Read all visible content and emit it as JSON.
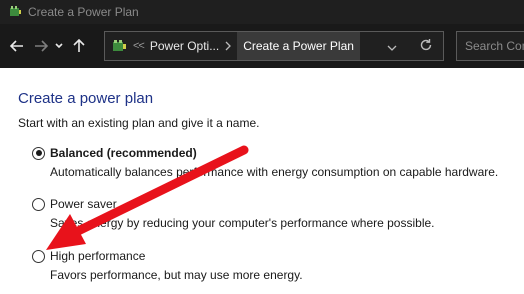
{
  "window": {
    "title": "Create a Power Plan",
    "icon": "power-options-icon"
  },
  "nav": {
    "back_icon": "arrow-left-icon",
    "forward_icon": "arrow-right-icon",
    "recent_icon": "chevron-down-icon",
    "up_icon": "arrow-up-icon"
  },
  "address": {
    "overflow": "<<",
    "crumbs": [
      "Power Opti...",
      "Create a Power Plan"
    ],
    "refresh_icon": "refresh-icon"
  },
  "search": {
    "placeholder": "Search Cont"
  },
  "page": {
    "heading": "Create a power plan",
    "subtext": "Start with an existing plan and give it a name."
  },
  "plans": [
    {
      "label": "Balanced (recommended)",
      "description": "Automatically balances performance with energy consumption on capable hardware.",
      "selected": true
    },
    {
      "label": "Power saver",
      "description": "Saves energy by reducing your computer's performance where possible.",
      "selected": false
    },
    {
      "label": "High performance",
      "description": "Favors performance, but may use more energy.",
      "selected": false
    }
  ],
  "colors": {
    "heading": "#1e3287",
    "annotation_arrow": "#e8121b",
    "titlebar": "#1f1f1f"
  }
}
